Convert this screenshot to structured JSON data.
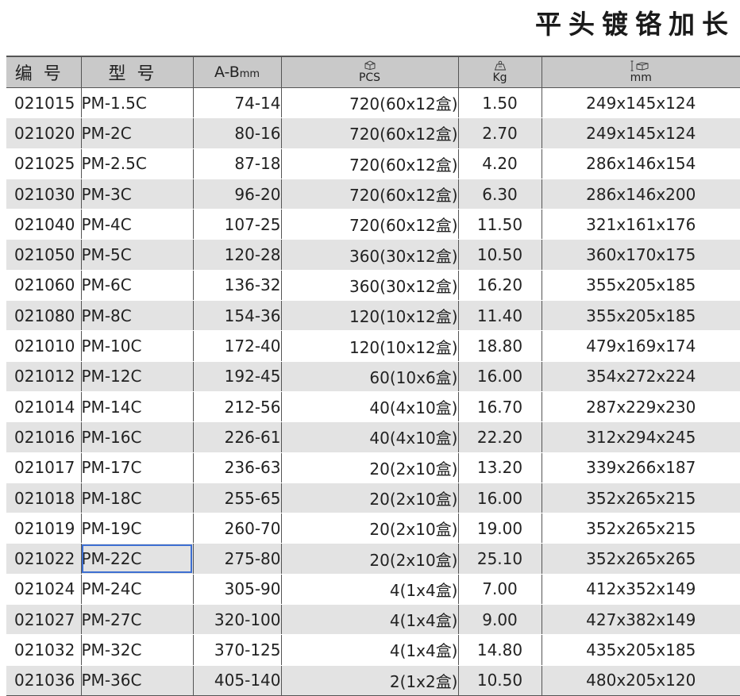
{
  "title": "平头镀铬加长",
  "header": {
    "col_code": "编号",
    "col_model": "型号",
    "col_ab": "A-B",
    "col_ab_unit": "mm",
    "col_pcs": "PCS",
    "col_kg": "Kg",
    "col_dim": "mm",
    "icons": {
      "pcs": "box-icon",
      "kg": "weight-icon",
      "dim": "carton-dimension-icon"
    }
  },
  "selected_row": 15,
  "selection_color": "#3e6fd1",
  "rows": [
    {
      "code": "021015",
      "model": "PM-1.5C",
      "ab": "74-14",
      "pcs": "720(60x12盒)",
      "kg": "1.50",
      "dim": "249x145x124"
    },
    {
      "code": "021020",
      "model": "PM-2C",
      "ab": "80-16",
      "pcs": "720(60x12盒)",
      "kg": "2.70",
      "dim": "249x145x124"
    },
    {
      "code": "021025",
      "model": "PM-2.5C",
      "ab": "87-18",
      "pcs": "720(60x12盒)",
      "kg": "4.20",
      "dim": "286x146x154"
    },
    {
      "code": "021030",
      "model": "PM-3C",
      "ab": "96-20",
      "pcs": "720(60x12盒)",
      "kg": "6.30",
      "dim": "286x146x200"
    },
    {
      "code": "021040",
      "model": "PM-4C",
      "ab": "107-25",
      "pcs": "720(60x12盒)",
      "kg": "11.50",
      "dim": "321x161x176"
    },
    {
      "code": "021050",
      "model": "PM-5C",
      "ab": "120-28",
      "pcs": "360(30x12盒)",
      "kg": "10.50",
      "dim": "360x170x175"
    },
    {
      "code": "021060",
      "model": "PM-6C",
      "ab": "136-32",
      "pcs": "360(30x12盒)",
      "kg": "16.20",
      "dim": "355x205x185"
    },
    {
      "code": "021080",
      "model": "PM-8C",
      "ab": "154-36",
      "pcs": "120(10x12盒)",
      "kg": "11.40",
      "dim": "355x205x185"
    },
    {
      "code": "021010",
      "model": "PM-10C",
      "ab": "172-40",
      "pcs": "120(10x12盒)",
      "kg": "18.80",
      "dim": "479x169x174"
    },
    {
      "code": "021012",
      "model": "PM-12C",
      "ab": "192-45",
      "pcs": "60(10x6盒)",
      "kg": "16.00",
      "dim": "354x272x224"
    },
    {
      "code": "021014",
      "model": "PM-14C",
      "ab": "212-56",
      "pcs": "40(4x10盒)",
      "kg": "16.70",
      "dim": "287x229x230"
    },
    {
      "code": "021016",
      "model": "PM-16C",
      "ab": "226-61",
      "pcs": "40(4x10盒)",
      "kg": "22.20",
      "dim": "312x294x245"
    },
    {
      "code": "021017",
      "model": "PM-17C",
      "ab": "236-63",
      "pcs": "20(2x10盒)",
      "kg": "13.20",
      "dim": "339x266x187"
    },
    {
      "code": "021018",
      "model": "PM-18C",
      "ab": "255-65",
      "pcs": "20(2x10盒)",
      "kg": "16.00",
      "dim": "352x265x215"
    },
    {
      "code": "021019",
      "model": "PM-19C",
      "ab": "260-70",
      "pcs": "20(2x10盒)",
      "kg": "19.00",
      "dim": "352x265x215"
    },
    {
      "code": "021022",
      "model": "PM-22C",
      "ab": "275-80",
      "pcs": "20(2x10盒)",
      "kg": "25.10",
      "dim": "352x265x265"
    },
    {
      "code": "021024",
      "model": "PM-24C",
      "ab": "305-90",
      "pcs": "4(1x4盒)",
      "kg": "7.00",
      "dim": "412x352x149"
    },
    {
      "code": "021027",
      "model": "PM-27C",
      "ab": "320-100",
      "pcs": "4(1x4盒)",
      "kg": "9.00",
      "dim": "427x382x149"
    },
    {
      "code": "021032",
      "model": "PM-32C",
      "ab": "370-125",
      "pcs": "4(1x4盒)",
      "kg": "14.80",
      "dim": "435x205x185"
    },
    {
      "code": "021036",
      "model": "PM-36C",
      "ab": "405-140",
      "pcs": "2(1x2盒)",
      "kg": "10.50",
      "dim": "480x205x120"
    }
  ]
}
